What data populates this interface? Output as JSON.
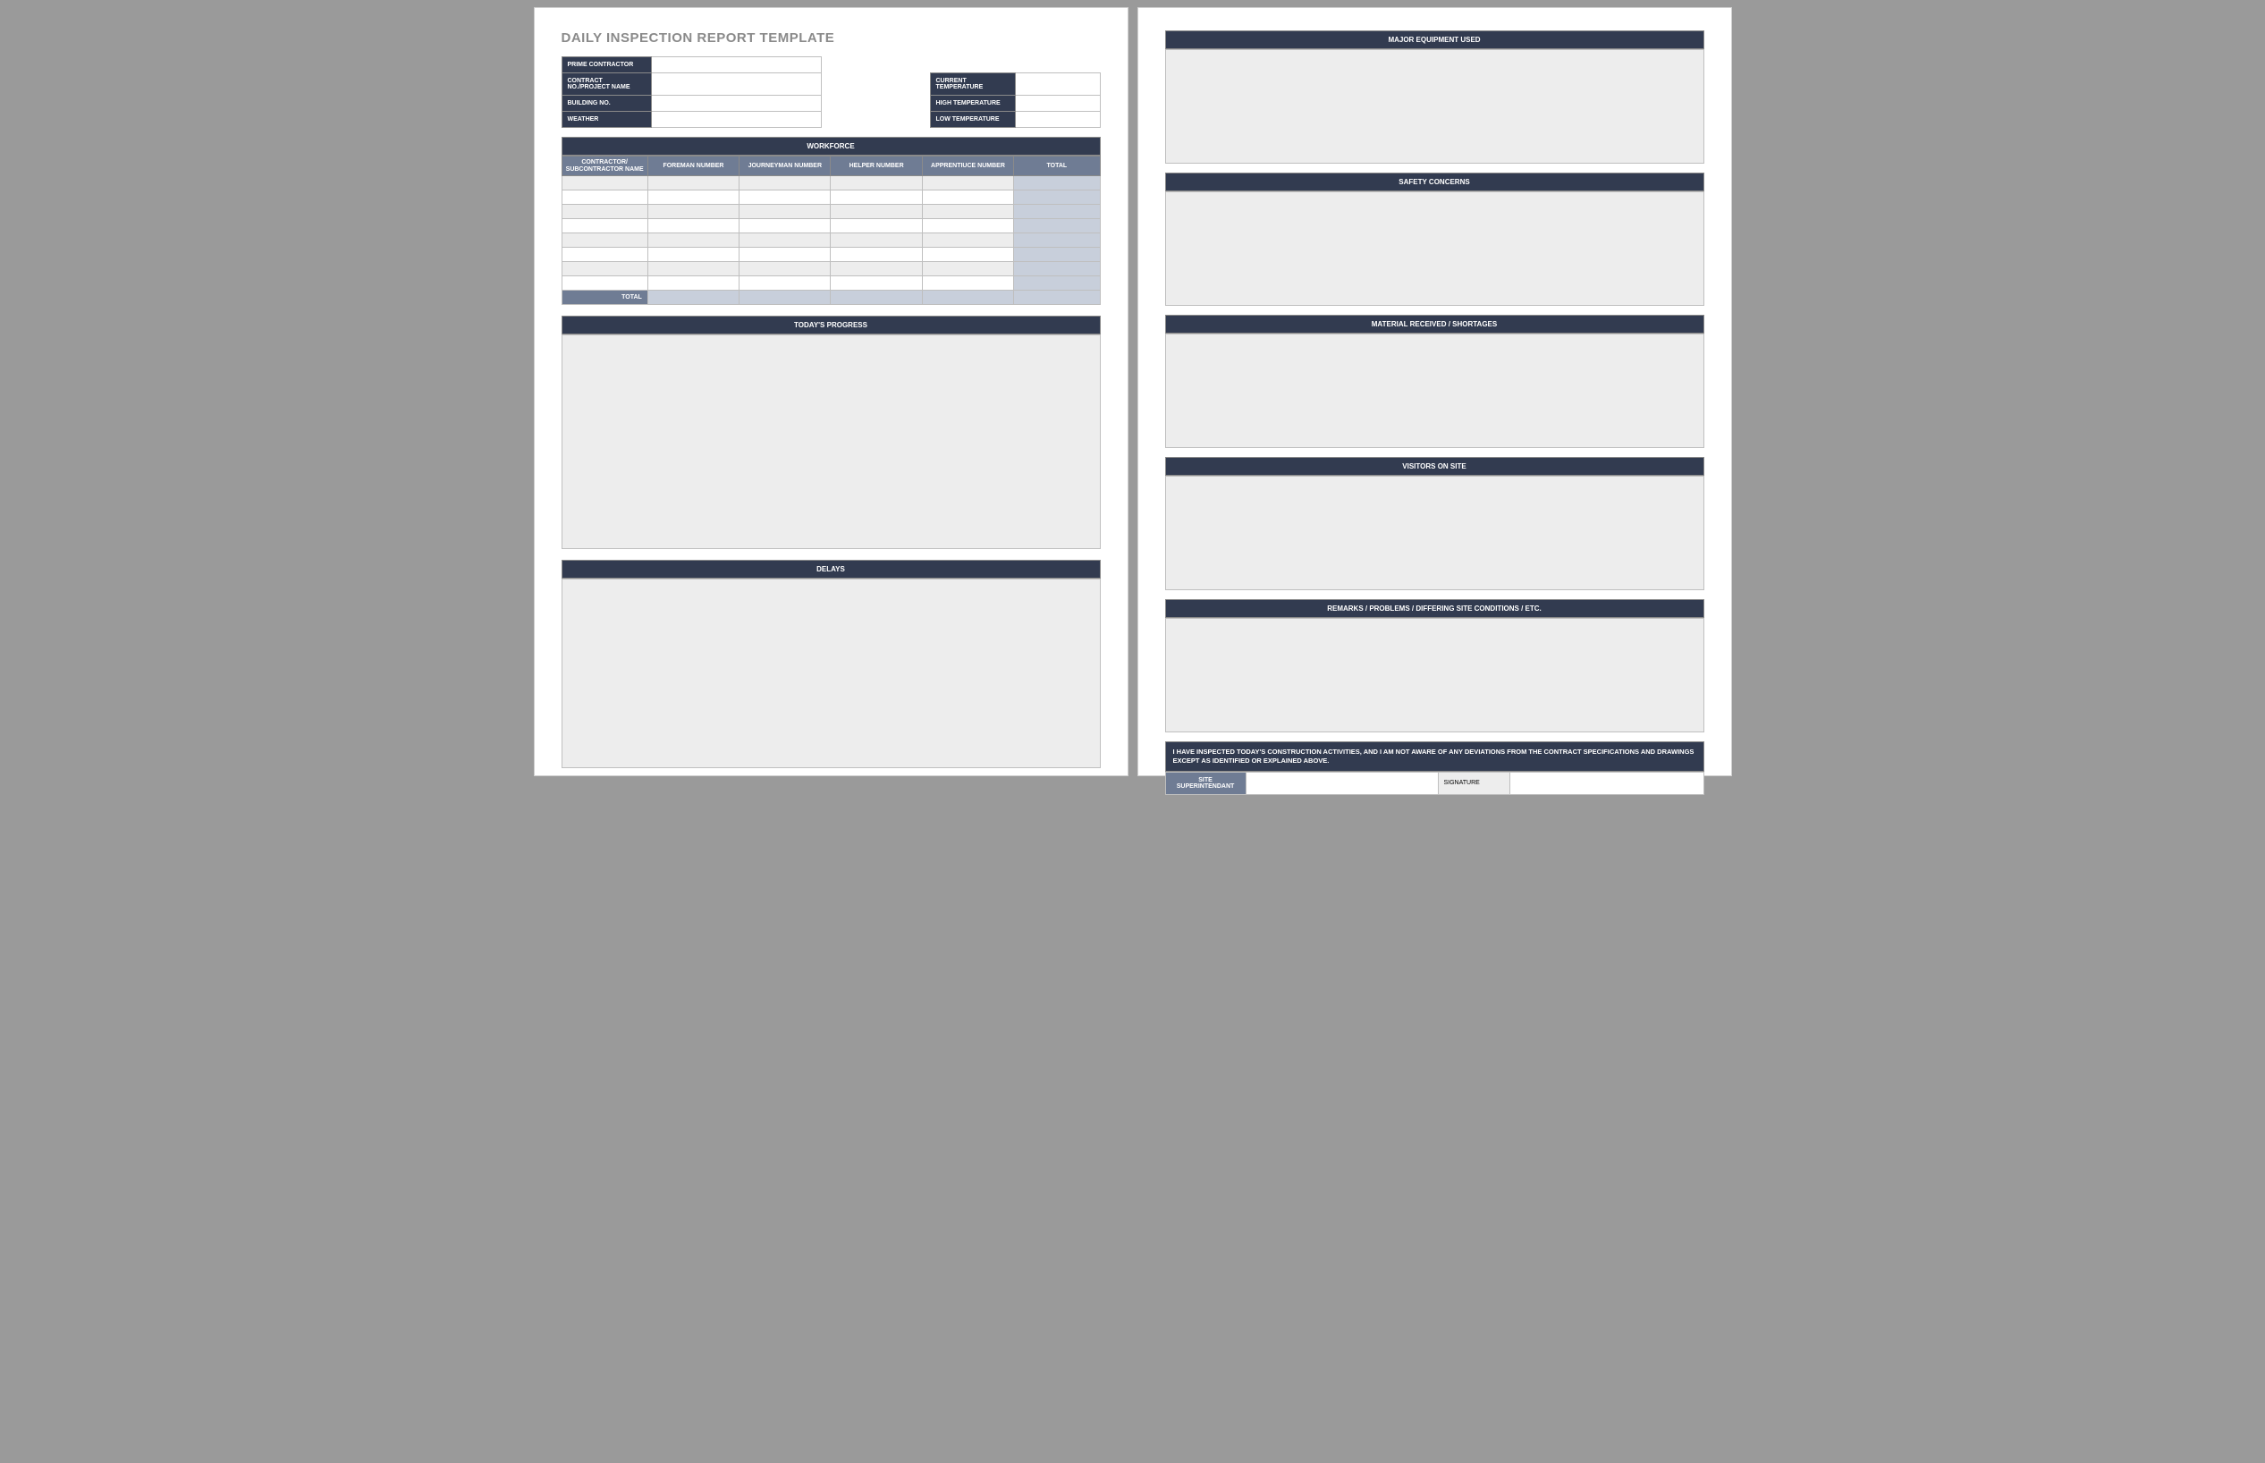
{
  "title": "DAILY INSPECTION REPORT TEMPLATE",
  "left_fields": {
    "prime_contractor": {
      "label": "PRIME CONTRACTOR",
      "value": ""
    },
    "contract_no": {
      "label": "CONTRACT NO./PROJECT NAME",
      "value": ""
    },
    "building_no": {
      "label": "BUILDING NO.",
      "value": ""
    },
    "weather": {
      "label": "WEATHER",
      "value": ""
    }
  },
  "temp_fields": {
    "current": {
      "label": "CURRENT TEMPERATURE",
      "value": ""
    },
    "high": {
      "label": "HIGH TEMPERATURE",
      "value": ""
    },
    "low": {
      "label": "LOW TEMPERATURE",
      "value": ""
    }
  },
  "workforce": {
    "header": "WORKFORCE",
    "columns": [
      "CONTRACTOR/ SUBCONTRACTOR NAME",
      "FOREMAN NUMBER",
      "JOURNEYMAN NUMBER",
      "HELPER NUMBER",
      "APPRENTIUCE NUMBER",
      "TOTAL"
    ],
    "rows": 8,
    "total_label": "TOTAL"
  },
  "sections": {
    "progress": "TODAY'S PROGRESS",
    "delays": "DELAYS",
    "equipment": "MAJOR EQUIPMENT USED",
    "safety": "SAFETY CONCERNS",
    "material": "MATERIAL RECEIVED / SHORTAGES",
    "visitors": "VISITORS ON SITE",
    "remarks": "REMARKS / PROBLEMS / DIFFERING SITE CONDITIONS / ETC."
  },
  "compliance_text": "I HAVE INSPECTED TODAY'S CONSTRUCTION ACTIVITIES, AND I AM NOT AWARE OF ANY DEVIATIONS FROM THE CONTRACT SPECIFICATIONS AND DRAWINGS EXCEPT AS IDENTIFIED OR EXPLAINED ABOVE.",
  "signoff": {
    "site_super_label": "SITE SUPERINTENDANT",
    "site_super_value": "",
    "signature_label": "SIGNATURE",
    "signature_value": ""
  }
}
